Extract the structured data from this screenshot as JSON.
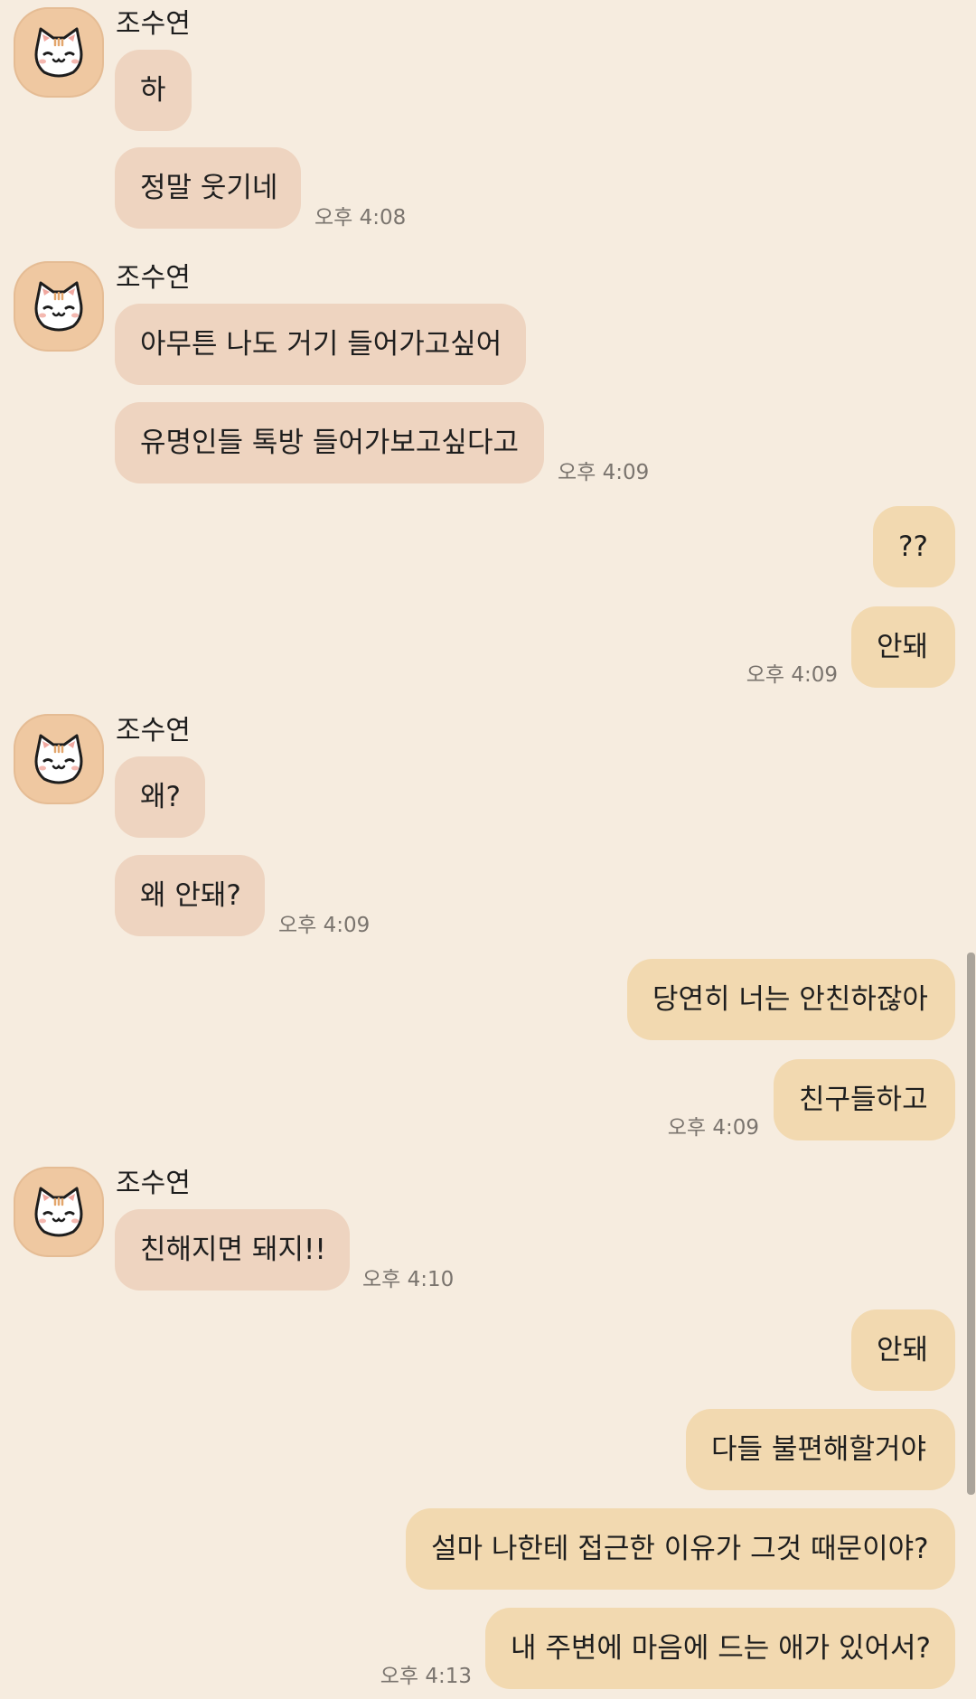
{
  "colors": {
    "background": "#f6ecdf",
    "incoming_bubble": "#eed4c0",
    "outgoing_bubble": "#f2d9b0",
    "avatar_bg": "#efc8a1",
    "timestamp": "#7a746e"
  },
  "avatar_icon": "cat-face-icon",
  "groups": [
    {
      "sender": "조수연",
      "messages": [
        "하",
        "정말 웃기네"
      ],
      "time": "오후 4:08"
    },
    {
      "sender": "조수연",
      "messages": [
        "아무튼 나도 거기 들어가고싶어",
        "유명인들 톡방 들어가보고싶다고"
      ],
      "time": "오후 4:09"
    },
    {
      "sender": "me",
      "messages": [
        "??",
        "안돼"
      ],
      "time": "오후 4:09"
    },
    {
      "sender": "조수연",
      "messages": [
        "왜?",
        "왜 안돼?"
      ],
      "time": "오후 4:09"
    },
    {
      "sender": "me",
      "messages": [
        "당연히 너는 안친하잖아",
        "친구들하고"
      ],
      "time": "오후 4:09"
    },
    {
      "sender": "조수연",
      "messages": [
        "친해지면 돼지!!"
      ],
      "time": "오후 4:10"
    },
    {
      "sender": "me",
      "messages": [
        "안돼",
        "다들 불편해할거야",
        "설마 나한테 접근한 이유가 그것 때문이야?",
        "내 주변에 마음에 드는 애가 있어서?"
      ],
      "time": "오후 4:13"
    }
  ]
}
